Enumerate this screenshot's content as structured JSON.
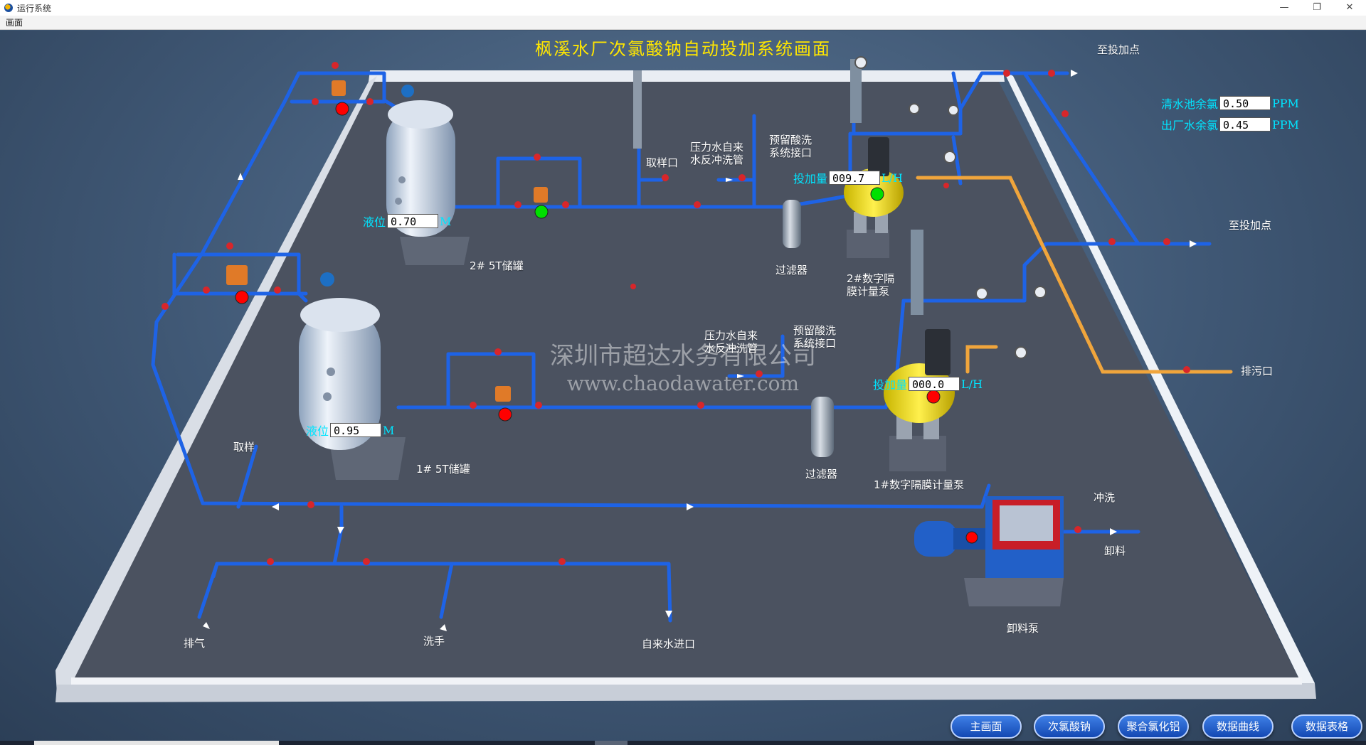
{
  "window": {
    "title": "运行系统",
    "menu": "画面",
    "min": "—",
    "max": "❐",
    "close": "✕"
  },
  "scene": {
    "title": "枫溪水厂次氯酸钠自动投加系统画面",
    "watermark_line1": "深圳市超达水务有限公司",
    "watermark_line2": "www.chaodawater.com"
  },
  "readouts": {
    "clear_pool_label": "清水池余氯",
    "clear_pool_value": "0.50",
    "clear_pool_unit": "PPM",
    "outlet_label": "出厂水余氯",
    "outlet_value": "0.45",
    "outlet_unit": "PPM",
    "tank2_level_label": "液位",
    "tank2_level_value": "0.70",
    "tank2_level_unit": "M",
    "tank1_level_label": "液位",
    "tank1_level_value": "0.95",
    "tank1_level_unit": "M",
    "pump2_dose_label": "投加量",
    "pump2_dose_value": "009.7",
    "pump2_dose_unit": "L/H",
    "pump1_dose_label": "投加量",
    "pump1_dose_value": "000.0",
    "pump1_dose_unit": "L/H"
  },
  "labels": {
    "to_dosing_point_top": "至投加点",
    "to_dosing_point_mid": "至投加点",
    "sewage_outlet": "排污口",
    "tank2": "2# 5T储罐",
    "tank1": "1# 5T储罐",
    "sampling_port": "取样口",
    "pressure_water_top": "压力水自来\n水反冲洗管",
    "reserved_acid_top": "预留酸洗\n系统接口",
    "pressure_water_mid": "压力水自来\n水反冲洗管",
    "reserved_acid_mid": "预留酸洗\n系统接口",
    "filter_top": "过滤器",
    "filter_mid": "过滤器",
    "pump2": "2#数字隔\n膜计量泵",
    "pump1": "1#数字隔膜计量泵",
    "sampling": "取样",
    "flush": "冲洗",
    "unload": "卸料",
    "unload_pump": "卸料泵",
    "exhaust": "排气",
    "hand_wash": "洗手",
    "tap_water_inlet": "自来水进口"
  },
  "indicators": {
    "valve_tank2": "#ff0000",
    "valve_tank1": "#ff0000",
    "valve_mid_top": "#00e000",
    "valve_mid_bottom": "#ff0000",
    "pump2_status": "#00e000",
    "pump1_status": "#ff0000",
    "unload_pump_status": "#ff0000"
  },
  "nav": {
    "main": "主画面",
    "naclo": "次氯酸钠",
    "pac": "聚合氯化铝",
    "curve": "数据曲线",
    "table": "数据表格"
  }
}
